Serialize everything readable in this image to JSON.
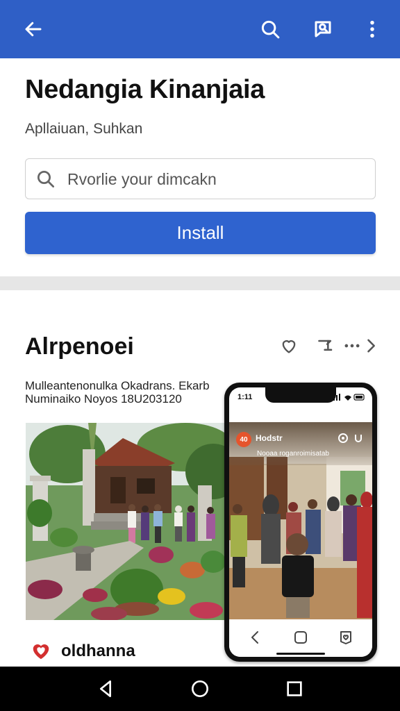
{
  "appbar": {
    "back_icon": "arrow-left-icon",
    "search_icon": "search-icon",
    "feedback_icon": "chat-search-icon",
    "menu_icon": "more-vert-icon",
    "color": "#2f5fc6"
  },
  "header": {
    "title": "Nedangia Kinanjaia",
    "subtitle": "Apllaiuan, Suhkan",
    "search_placeholder": "Rvorlie your dimcakn",
    "install_label": "Install",
    "accent": "#2f63cf"
  },
  "section": {
    "title": "Alrpenoei",
    "meta_line1": "Mulleantenonulka Okadrans. Ekarb",
    "meta_line2": "Numinaiko Noyos 18U203120",
    "actions": [
      "heart-outline-icon",
      "share-icon",
      "more-horiz-icon",
      "chevron-right-icon"
    ]
  },
  "phone": {
    "time": "1:11",
    "video_avatar": "40",
    "video_name": "Hodstr",
    "video_sub": "Nooaa roganroimisatab",
    "nav_icons": [
      "back-icon",
      "home-square-icon",
      "bookmark-heart-icon"
    ]
  },
  "footer": {
    "brand": "oldhanna",
    "brand_icon": "heart-logo-icon",
    "brand_color": "#d32f2f"
  },
  "system_nav": [
    "nav-back-icon",
    "nav-home-icon",
    "nav-recents-icon"
  ]
}
